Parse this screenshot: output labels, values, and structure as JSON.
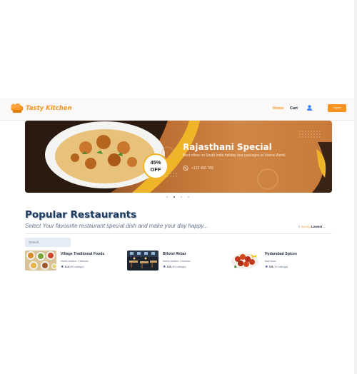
{
  "header": {
    "brand": "Tasty Kitchen",
    "nav": {
      "home": "Home",
      "cart": "Cart"
    },
    "logout_label": "Logout",
    "colors": {
      "accent": "#f7931e",
      "nav_text": "#1e293b"
    }
  },
  "banner": {
    "title": "Rajasthani Special",
    "subtitle": "Best offers on South India holiday tour packages at Veena World.",
    "phone": "+123 456 789",
    "discount_pct": "45%",
    "discount_off": "OFF",
    "carousel_total": 4,
    "carousel_active": 2
  },
  "popular": {
    "title": "Popular Restaurants",
    "subtitle": "Select Your favourite restaurant special dish and make your day happy...",
    "sort": {
      "label": "Sort By",
      "value": "Lowest"
    },
    "search_placeholder": "Search"
  },
  "restaurants": [
    {
      "name": "Village Traditional Foods",
      "cuisine": "North Indian, Chinese",
      "rating": "3.4",
      "ratings_count": "(89 ratings)"
    },
    {
      "name": "BHotel Akbar",
      "cuisine": "North Indian, Chinese",
      "rating": "3.3",
      "ratings_count": "(61 ratings)"
    },
    {
      "name": "Hydarabad Spices",
      "cuisine": "fast food",
      "rating": "3.5",
      "ratings_count": "(11 ratings)"
    }
  ]
}
